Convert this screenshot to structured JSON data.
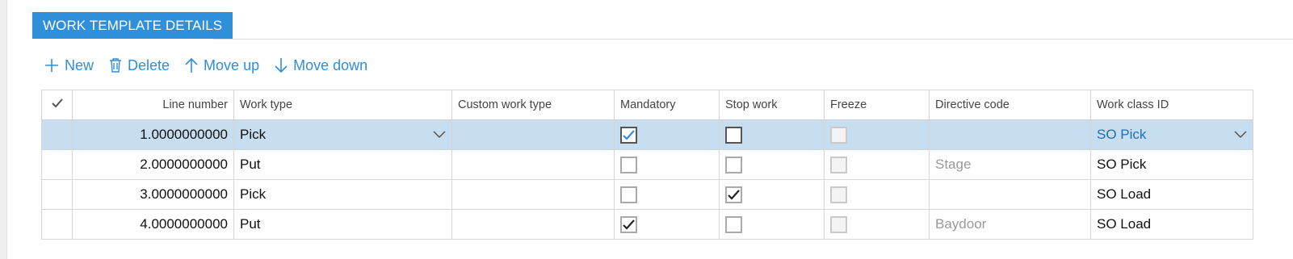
{
  "header": {
    "title": "WORK TEMPLATE DETAILS"
  },
  "toolbar": {
    "new_label": "New",
    "delete_label": "Delete",
    "move_up_label": "Move up",
    "move_down_label": "Move down"
  },
  "columns": {
    "select": "✓",
    "line_number": "Line number",
    "work_type": "Work type",
    "custom_work_type": "Custom work type",
    "mandatory": "Mandatory",
    "stop_work": "Stop work",
    "freeze": "Freeze",
    "directive_code": "Directive code",
    "work_class_id": "Work class ID"
  },
  "rows": [
    {
      "line_number": "1.0000000000",
      "work_type": "Pick",
      "custom_work_type": "",
      "mandatory": true,
      "stop_work": false,
      "freeze": false,
      "directive_code": "",
      "work_class_id": "SO Pick",
      "selected": true
    },
    {
      "line_number": "2.0000000000",
      "work_type": "Put",
      "custom_work_type": "",
      "mandatory": false,
      "stop_work": false,
      "freeze": false,
      "directive_code": "Stage",
      "work_class_id": "SO Pick",
      "selected": false
    },
    {
      "line_number": "3.0000000000",
      "work_type": "Pick",
      "custom_work_type": "",
      "mandatory": false,
      "stop_work": true,
      "freeze": false,
      "directive_code": "",
      "work_class_id": "SO Load",
      "selected": false
    },
    {
      "line_number": "4.0000000000",
      "work_type": "Put",
      "custom_work_type": "",
      "mandatory": true,
      "stop_work": false,
      "freeze": false,
      "directive_code": "Baydoor",
      "work_class_id": "SO Load",
      "selected": false
    }
  ],
  "colors": {
    "accent": "#2f8fd8",
    "selected_row": "#c7ddf0",
    "link": "#1f6fb5"
  },
  "icons": {
    "new": "plus-icon",
    "delete": "trash-icon",
    "move_up": "arrow-up-icon",
    "move_down": "arrow-down-icon",
    "dropdown": "chevron-down-icon",
    "check": "checkmark-icon"
  }
}
